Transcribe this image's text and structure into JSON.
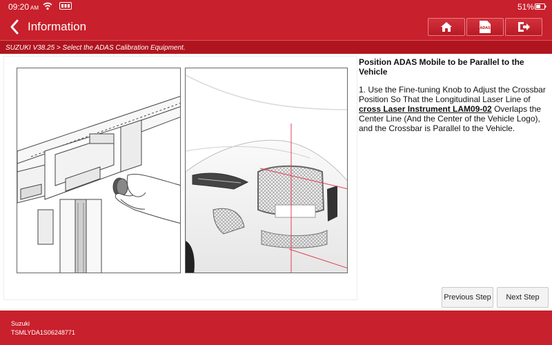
{
  "status": {
    "time": "09:20",
    "ampm": "AM",
    "battery": "51%"
  },
  "header": {
    "title": "Information",
    "icons": [
      "back-arrow-icon",
      "home-icon",
      "adas-report-icon",
      "exit-icon"
    ],
    "report_badge": "ADAS"
  },
  "breadcrumb": "SUZUKI V38.25 > Select the ADAS Calibration Equipment.",
  "instruction": {
    "heading": "Position ADAS Mobile to be Parallel to the Vehicle",
    "text_before": "1. Use the Fine-tuning Knob to Adjust the Crossbar Position So That the Longitudinal Laser Line of ",
    "link": "cross Laser Instrument LAM09-02",
    "text_after": " Overlaps the Center Line (And the Center of the Vehicle Logo), and the Crossbar is Parallel to the Vehicle."
  },
  "buttons": {
    "previous": "Previous Step",
    "next": "Next Step"
  },
  "footer": {
    "make": "Suzuki",
    "vin": "TSMLYDA1S06248771"
  },
  "colors": {
    "brand_red": "#c8202c",
    "breadcrumb_red": "#b0151f",
    "laser_line": "#e04050"
  }
}
